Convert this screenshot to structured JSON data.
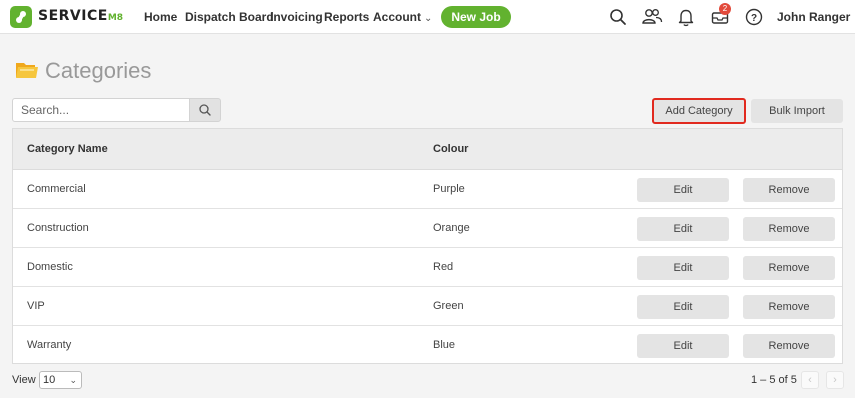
{
  "brand": {
    "name": "SERVICE",
    "suffix": "M8",
    "color": "#62b22f"
  },
  "nav": {
    "home": "Home",
    "dispatch": "Dispatch Board",
    "invoicing": "Invoicing",
    "reports": "Reports",
    "account": "Account",
    "new_job": "New Job"
  },
  "toolbar_icons": [
    "search-icon",
    "people-icon",
    "bell-icon",
    "inbox-icon",
    "help-icon"
  ],
  "inbox_badge": "2",
  "user": "John Ranger",
  "page": {
    "title": "Categories"
  },
  "search": {
    "placeholder": "Search..."
  },
  "actions": {
    "add_category": "Add Category",
    "bulk_import": "Bulk Import"
  },
  "table": {
    "headers": {
      "name": "Category Name",
      "colour": "Colour"
    },
    "rows": [
      {
        "name": "Commercial",
        "colour": "Purple"
      },
      {
        "name": "Construction",
        "colour": "Orange"
      },
      {
        "name": "Domestic",
        "colour": "Red"
      },
      {
        "name": "VIP",
        "colour": "Green"
      },
      {
        "name": "Warranty",
        "colour": "Blue"
      }
    ],
    "edit_label": "Edit",
    "remove_label": "Remove"
  },
  "footer": {
    "view_label": "View",
    "page_size": "10",
    "range": "1 – 5 of 5"
  }
}
